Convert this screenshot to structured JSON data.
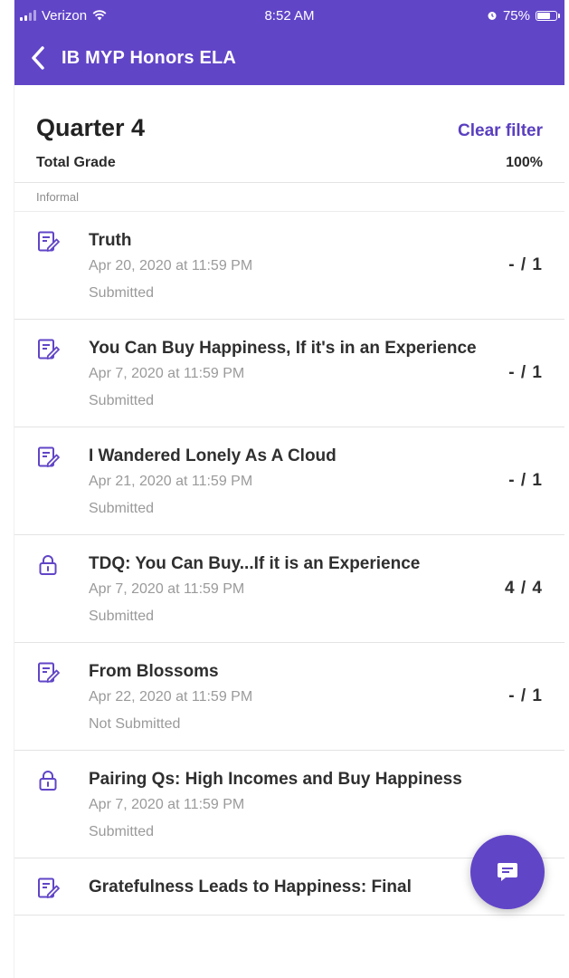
{
  "status_bar": {
    "carrier": "Verizon",
    "time": "8:52 AM",
    "battery": "75%",
    "battery_level": 0.75
  },
  "header": {
    "title": "IB MYP Honors ELA",
    "back_icon": "chevron-left-icon"
  },
  "quarter": {
    "title": "Quarter 4",
    "clear_filter": "Clear filter",
    "total_label": "Total Grade",
    "total_value": "100%"
  },
  "section": {
    "label": "Informal"
  },
  "items": [
    {
      "icon": "assignment-icon",
      "title": "Truth",
      "date": "Apr 20, 2020 at 11:59 PM",
      "status": "Submitted",
      "score": "- / 1"
    },
    {
      "icon": "assignment-icon",
      "title": "You Can Buy Happiness, If it's in an Experience",
      "date": "Apr 7, 2020 at 11:59 PM",
      "status": "Submitted",
      "score": "- / 1"
    },
    {
      "icon": "assignment-icon",
      "title": "I Wandered Lonely As A Cloud",
      "date": "Apr 21, 2020 at 11:59 PM",
      "status": "Submitted",
      "score": "- / 1"
    },
    {
      "icon": "lock-icon",
      "title": "TDQ: You Can Buy...If it is an Experience",
      "date": "Apr 7, 2020 at 11:59 PM",
      "status": "Submitted",
      "score": "4 / 4"
    },
    {
      "icon": "assignment-icon",
      "title": "From Blossoms",
      "date": "Apr 22, 2020 at 11:59 PM",
      "status": "Not Submitted",
      "score": "- / 1"
    },
    {
      "icon": "lock-icon",
      "title": "Pairing Qs: High Incomes and Buy Happiness",
      "date": "Apr 7, 2020 at 11:59 PM",
      "status": "Submitted",
      "score": ""
    },
    {
      "icon": "assignment-icon",
      "title": "Gratefulness Leads to Happiness: Final",
      "date": "",
      "status": "",
      "score": ""
    }
  ],
  "fab": {
    "icon": "message-icon"
  },
  "colors": {
    "brand": "#6145c7",
    "link": "#5a3fc0",
    "muted_text": "#9a9a9a"
  }
}
